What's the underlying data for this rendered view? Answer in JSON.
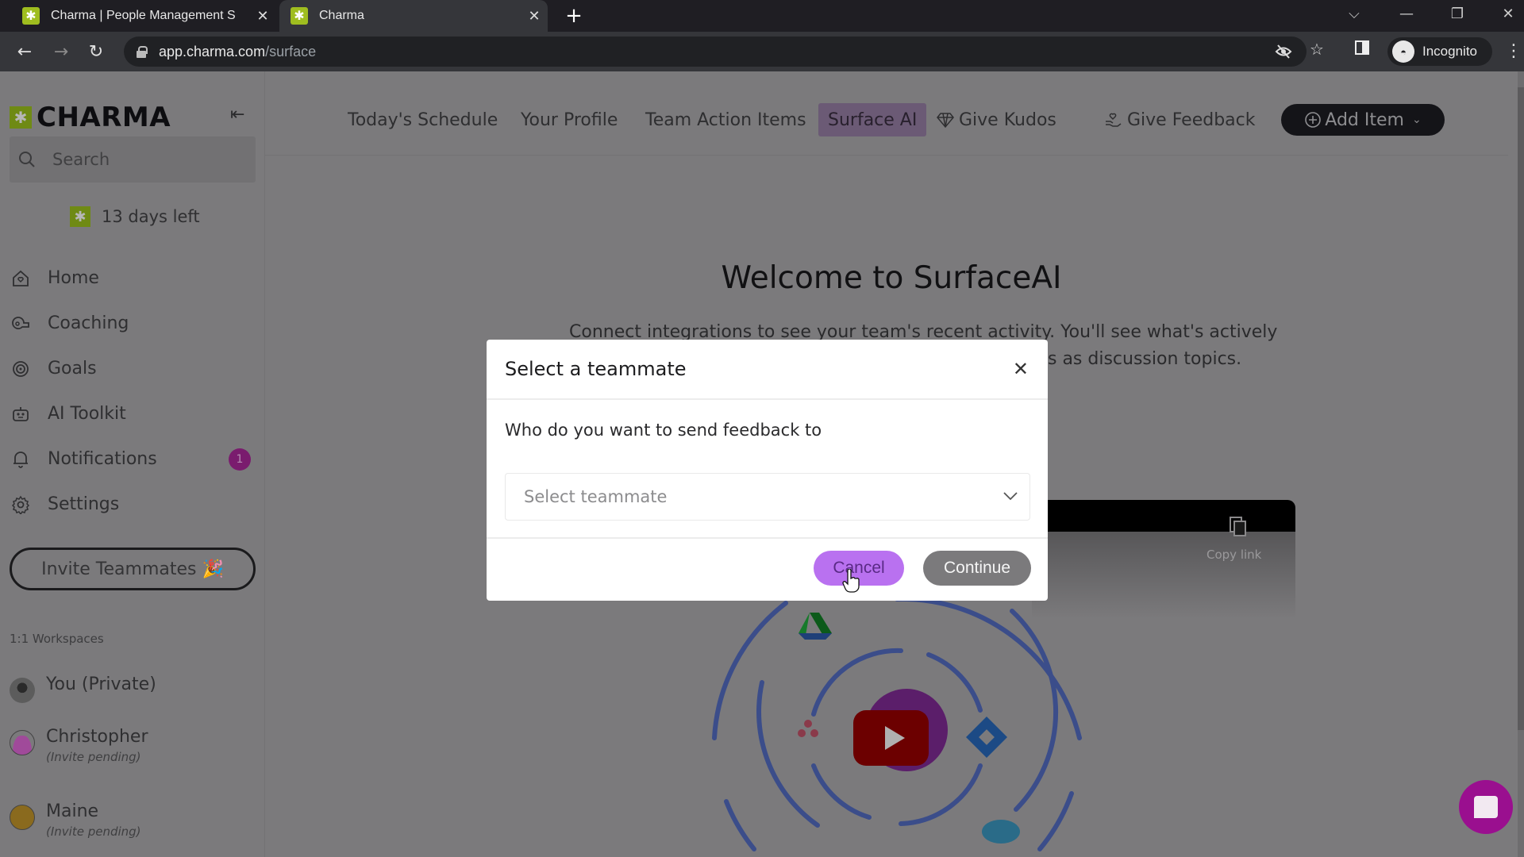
{
  "browser": {
    "tabs": [
      {
        "title": "Charma | People Management S",
        "active": false
      },
      {
        "title": "Charma",
        "active": true
      }
    ],
    "url_host": "app.charma.com",
    "url_path": "/surface",
    "profile_label": "Incognito"
  },
  "sidebar": {
    "logo_text": "CHARMA",
    "search_placeholder": "Search",
    "trial_text": "13 days left",
    "nav": [
      {
        "label": "Home",
        "icon": "home-icon"
      },
      {
        "label": "Coaching",
        "icon": "whistle-icon"
      },
      {
        "label": "Goals",
        "icon": "target-icon"
      },
      {
        "label": "AI Toolkit",
        "icon": "robot-icon"
      },
      {
        "label": "Notifications",
        "icon": "bell-icon",
        "badge": "1"
      },
      {
        "label": "Settings",
        "icon": "gear-icon"
      }
    ],
    "invite_label": "Invite Teammates 🎉",
    "workspaces_label": "1:1 Workspaces",
    "workspaces": [
      {
        "name": "You (Private)",
        "sub": ""
      },
      {
        "name": "Christopher",
        "sub": "(Invite pending)"
      },
      {
        "name": "Maine",
        "sub": "(Invite pending)"
      }
    ]
  },
  "topnav": {
    "items": [
      "Today's Schedule",
      "Your Profile",
      "Team Action Items",
      "Surface AI",
      "Give Kudos",
      "Give Feedback"
    ],
    "active": "Surface AI",
    "add_item_label": "Add Item"
  },
  "main": {
    "title": "Welcome to SurfaceAI",
    "desc_line1": "Connect integrations to see your team's recent activity. You'll see what's actively",
    "desc_line2_visible": "s as discussion topics.",
    "video_copy_link": "Copy link"
  },
  "modal": {
    "title": "Select a teammate",
    "question": "Who do you want to send feedback to",
    "select_placeholder": "Select teammate",
    "cancel_label": "Cancel",
    "continue_label": "Continue"
  },
  "colors": {
    "brand_green": "#9fbd1f",
    "accent_purple": "#b971f0",
    "badge_magenta": "#a0178f",
    "overlay_gray": "#7b7a7c"
  }
}
